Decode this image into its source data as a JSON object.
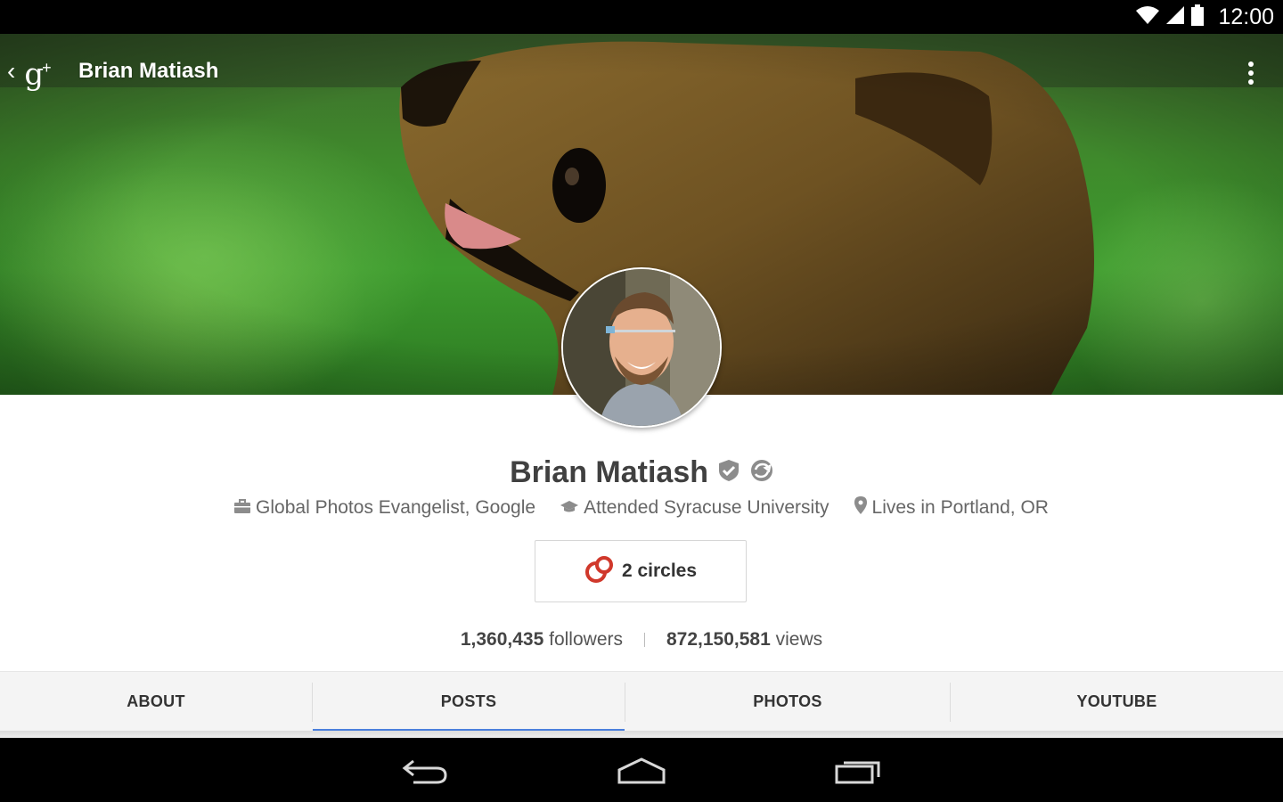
{
  "status_bar": {
    "time": "12:00",
    "icons": [
      "wifi-icon",
      "cell-signal-icon",
      "battery-icon"
    ]
  },
  "action_bar": {
    "title": "Brian Matiash",
    "app_icon": "google-plus-icon",
    "app_glyph": "g",
    "app_glyph_plus": "+",
    "up_icon": "chevron-left-icon",
    "overflow_icon": "overflow-menu-icon"
  },
  "profile": {
    "name": "Brian Matiash",
    "badges": [
      "verified-icon",
      "hangouts-sync-icon"
    ],
    "details": [
      {
        "icon": "briefcase-icon",
        "text": "Global Photos Evangelist, Google"
      },
      {
        "icon": "graduation-cap-icon",
        "text": "Attended Syracuse University"
      },
      {
        "icon": "location-pin-icon",
        "text": "Lives in Portland, OR"
      }
    ],
    "circles_button": {
      "icon": "circles-icon",
      "label": "2 circles"
    },
    "stats": {
      "followers_count": "1,360,435",
      "followers_label": "followers",
      "views_count": "872,150,581",
      "views_label": "views"
    }
  },
  "tabs": [
    {
      "label": "ABOUT",
      "active": false
    },
    {
      "label": "POSTS",
      "active": true
    },
    {
      "label": "PHOTOS",
      "active": false
    },
    {
      "label": "YOUTUBE",
      "active": false
    }
  ],
  "nav_bar": {
    "buttons": [
      "back-icon",
      "home-icon",
      "recent-apps-icon"
    ]
  },
  "colors": {
    "tab_indicator": "#4a7fdc",
    "circles_red": "#d0382b",
    "status_bar": "#000000",
    "nav_bar": "#000000"
  }
}
